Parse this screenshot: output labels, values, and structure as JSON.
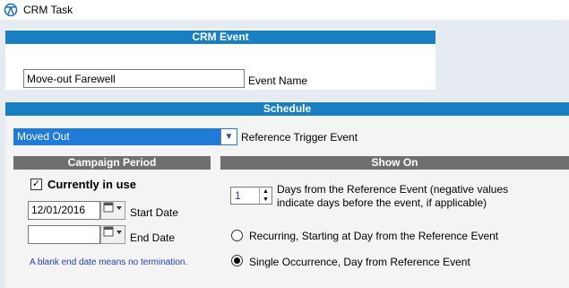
{
  "window": {
    "title": "CRM Task"
  },
  "event": {
    "header": "CRM Event",
    "name_value": "Move-out Farewell",
    "name_label": "Event Name"
  },
  "schedule": {
    "header": "Schedule",
    "trigger_value": "Moved Out",
    "trigger_label": "Reference Trigger Event",
    "campaign": {
      "header": "Campaign Period",
      "currently_in_use_label": "Currently in use",
      "currently_in_use_checked": true,
      "start_date_value": "12/01/2016",
      "start_date_label": "Start Date",
      "end_date_value": "",
      "end_date_label": "End Date",
      "note": "A blank end date means no termination."
    },
    "show_on": {
      "header": "Show On",
      "days_value": "1",
      "days_label": "Days from the Reference Event (negative values indicate days before the event, if applicable)",
      "recurring_label": "Recurring, Starting at Day from the Reference Event",
      "single_label": "Single Occurrence, Day from Reference Event",
      "selected": "single"
    }
  },
  "colors": {
    "header_blue": "#1a7fc1",
    "header_gray": "#6f6f6f",
    "selection_blue": "#1f7bd6"
  },
  "icons": [
    "app-icon",
    "calendar-icon",
    "dropdown-arrow-icon",
    "spin-up-icon",
    "spin-down-icon",
    "checkmark-icon"
  ]
}
